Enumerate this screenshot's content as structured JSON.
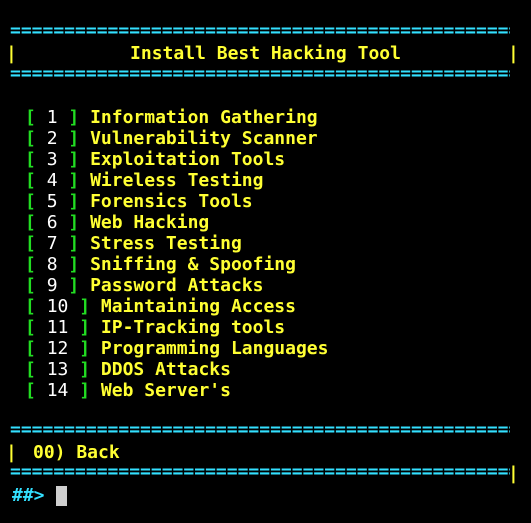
{
  "header": {
    "rule": "==================================================================",
    "pipe": "|",
    "title": "Install Best Hacking Tool"
  },
  "menu": {
    "open_bracket": "[",
    "close_bracket": "]",
    "items": [
      {
        "number": "1",
        "label": "Information Gathering"
      },
      {
        "number": "2",
        "label": "Vulnerability Scanner"
      },
      {
        "number": "3",
        "label": "Exploitation Tools"
      },
      {
        "number": "4",
        "label": "Wireless Testing"
      },
      {
        "number": "5",
        "label": "Forensics Tools"
      },
      {
        "number": "6",
        "label": "Web Hacking"
      },
      {
        "number": "7",
        "label": "Stress Testing"
      },
      {
        "number": "8",
        "label": "Sniffing & Spoofing"
      },
      {
        "number": "9",
        "label": "Password Attacks"
      },
      {
        "number": "10",
        "label": "Maintaining Access"
      },
      {
        "number": "11",
        "label": "IP-Tracking tools"
      },
      {
        "number": "12",
        "label": "Programming Languages"
      },
      {
        "number": "13",
        "label": "DDOS Attacks"
      },
      {
        "number": "14",
        "label": "Web Server's"
      }
    ]
  },
  "footer": {
    "back_label": "00) Back"
  },
  "prompt": {
    "text": "##>"
  },
  "colors": {
    "background": "#000000",
    "rule": "#33e0ff",
    "title": "#ffff33",
    "bracket": "#22dd22",
    "number": "#ffffff",
    "label": "#ffff33",
    "prompt": "#33e0ff",
    "cursor": "#cfcfcf"
  }
}
